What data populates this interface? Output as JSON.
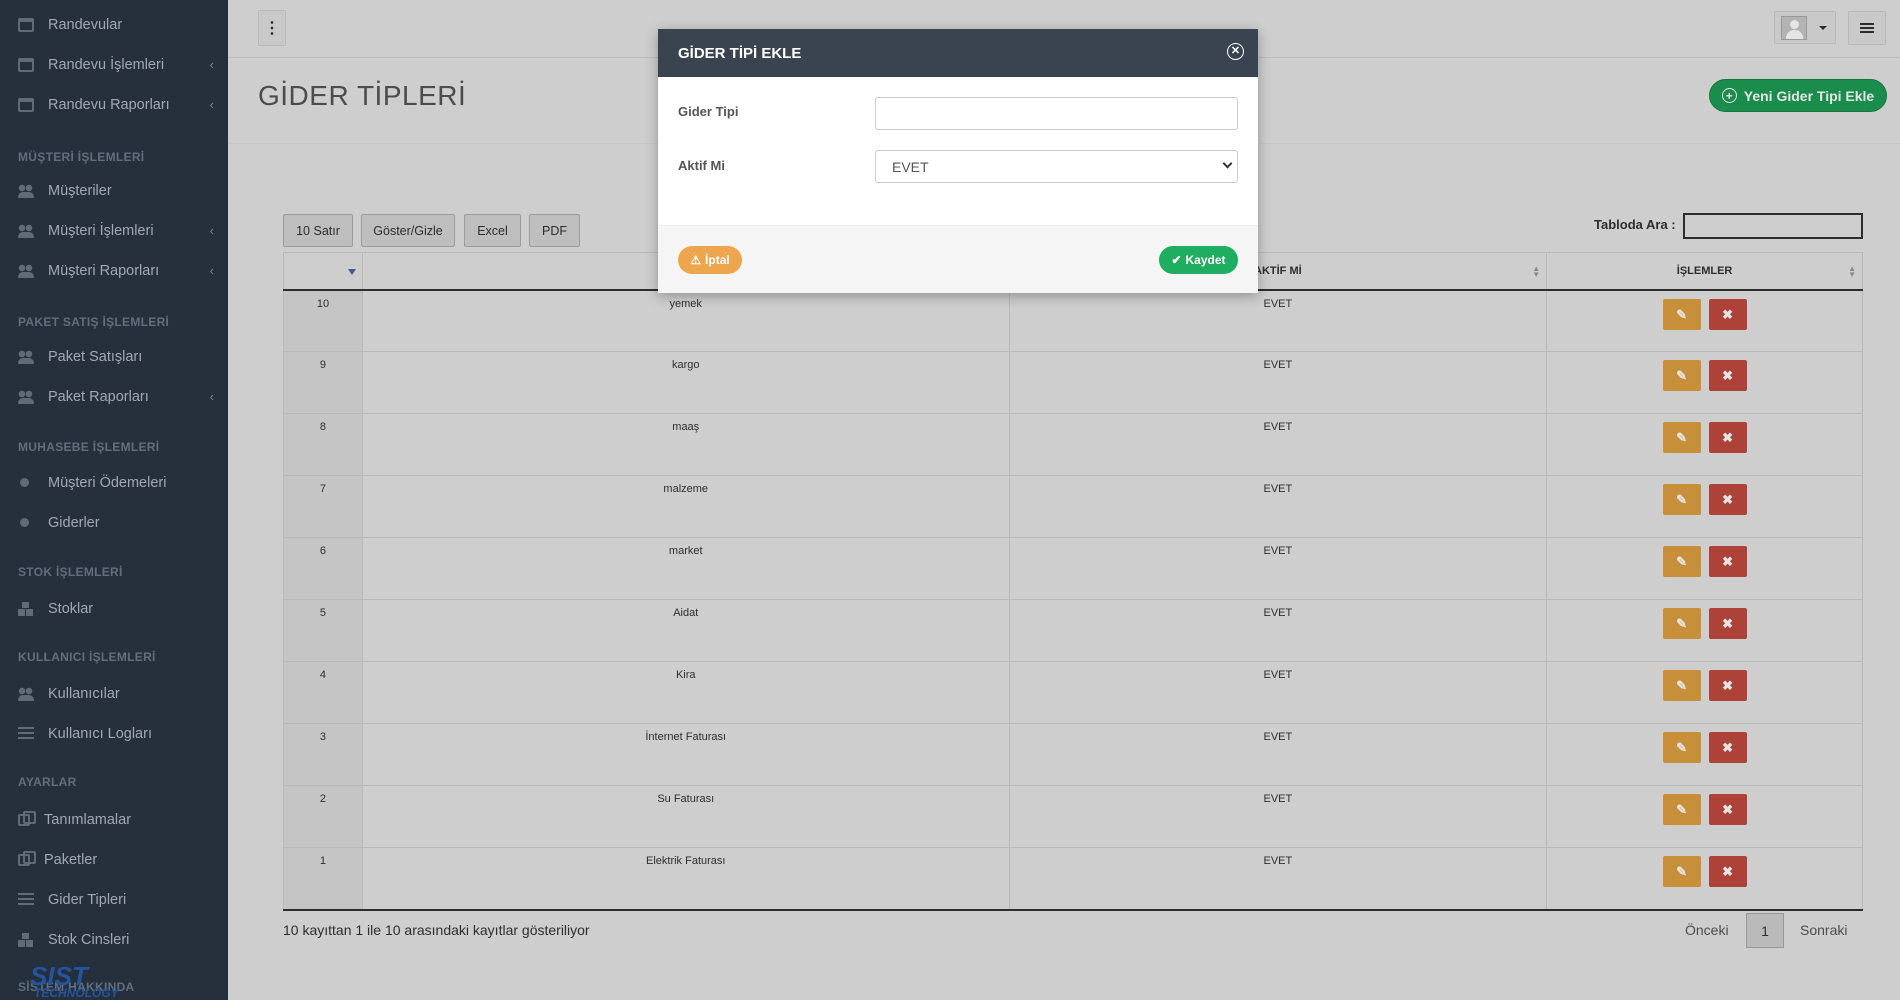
{
  "sidebar": {
    "items": [
      {
        "label": "Randevular",
        "icon": "calendar-icon"
      },
      {
        "label": "Randevu İşlemleri",
        "icon": "calendar-icon"
      },
      {
        "label": "Randevu Raporları",
        "icon": "calendar-icon"
      },
      {
        "label": "Müşteriler",
        "icon": "users-icon"
      },
      {
        "label": "Müşteri İşlemleri",
        "icon": "users-icon"
      },
      {
        "label": "Müşteri Raporları",
        "icon": "users-icon"
      },
      {
        "label": "Paket Satışları",
        "icon": "users-icon"
      },
      {
        "label": "Paket Raporları",
        "icon": "users-icon"
      },
      {
        "label": "Müşteri Ödemeleri",
        "icon": "dot-icon"
      },
      {
        "label": "Giderler",
        "icon": "dot-icon"
      },
      {
        "label": "Stoklar",
        "icon": "cubes-icon"
      },
      {
        "label": "Kullanıcılar",
        "icon": "users-icon"
      },
      {
        "label": "Kullanıcı Logları",
        "icon": "list-icon"
      },
      {
        "label": "Tanımlamalar",
        "icon": "copy-icon"
      },
      {
        "label": "Paketler",
        "icon": "copy-icon"
      },
      {
        "label": "Gider Tipleri",
        "icon": "list-icon"
      },
      {
        "label": "Stok Cinsleri",
        "icon": "cubes-icon"
      }
    ],
    "headings": [
      "MÜŞTERİ İŞLEMLERİ",
      "PAKET SATIŞ İŞLEMLERİ",
      "MUHASEBE İŞLEMLERİ",
      "STOK İŞLEMLERİ",
      "KULLANICI İŞLEMLERİ",
      "AYARLAR",
      "SİSTEM HAKKINDA"
    ],
    "logo_text": "SIST",
    "logo_sub": "TECHNOLOGY"
  },
  "page": {
    "title": "GİDER TİPLERİ",
    "new_button": "Yeni Gider Tipi Ekle"
  },
  "toolbar": {
    "rows_btn": "10 Satır",
    "toggle_btn": "Göster/Gizle",
    "excel_btn": "Excel",
    "pdf_btn": "PDF",
    "search_label": "Tabloda Ara :"
  },
  "table": {
    "headers": [
      "",
      "",
      "AKTİF Mİ",
      "İŞLEMLER"
    ],
    "rows": [
      {
        "id": "10",
        "name": "yemek",
        "active": "EVET"
      },
      {
        "id": "9",
        "name": "kargo",
        "active": "EVET"
      },
      {
        "id": "8",
        "name": "maaş",
        "active": "EVET"
      },
      {
        "id": "7",
        "name": "malzeme",
        "active": "EVET"
      },
      {
        "id": "6",
        "name": "market",
        "active": "EVET"
      },
      {
        "id": "5",
        "name": "Aidat",
        "active": "EVET"
      },
      {
        "id": "4",
        "name": "Kira",
        "active": "EVET"
      },
      {
        "id": "3",
        "name": "İnternet Faturası",
        "active": "EVET"
      },
      {
        "id": "2",
        "name": "Su Faturası",
        "active": "EVET"
      },
      {
        "id": "1",
        "name": "Elektrik Faturası",
        "active": "EVET"
      }
    ]
  },
  "pagination": {
    "info": "10 kayıttan 1 ile 10 arasındaki kayıtlar gösteriliyor",
    "prev": "Önceki",
    "page": "1",
    "next": "Sonraki"
  },
  "modal": {
    "title": "GİDER TİPİ EKLE",
    "field1_label": "Gider Tipi",
    "field1_value": "",
    "field2_label": "Aktif Mi",
    "field2_value": "EVET",
    "cancel": "İptal",
    "save": "Kaydet"
  }
}
